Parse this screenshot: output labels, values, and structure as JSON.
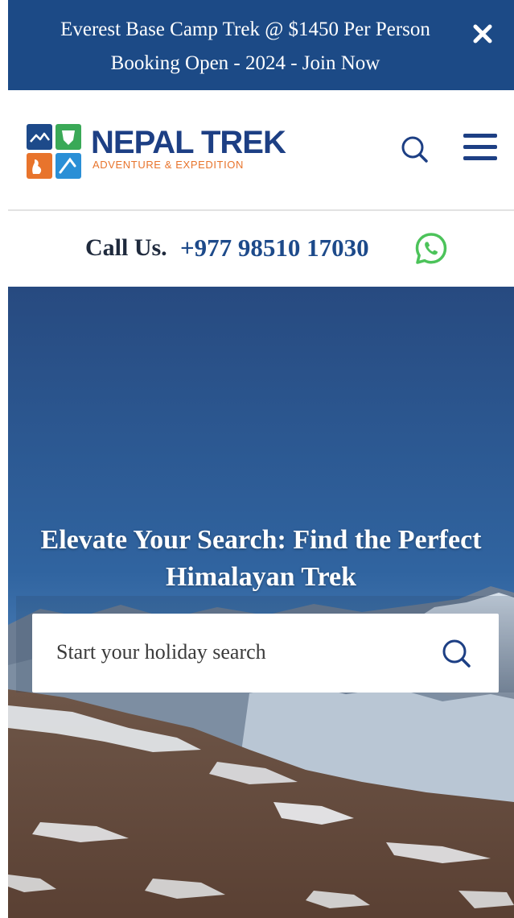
{
  "promo": {
    "line1": "Everest Base Camp Trek @ $1450 Per Person",
    "line2": "Booking Open - 2024 - Join Now",
    "close_icon": "close-icon",
    "background": "#1c4a86"
  },
  "header": {
    "logo": {
      "name": "NEPAL TREK",
      "tagline": "ADVENTURE & EXPEDITION",
      "brand_color": "#1d3f84",
      "tagline_color": "#e8742c"
    },
    "search_icon": "search-icon",
    "menu_icon": "hamburger-menu-icon"
  },
  "callbar": {
    "label": "Call Us.",
    "number": "+977 98510 17030",
    "whatsapp_icon": "whatsapp-icon",
    "whatsapp_color": "#4cc35a"
  },
  "hero": {
    "title": "Elevate Your Search: Find the Perfect Himalayan Trek",
    "search": {
      "placeholder": "Start your holiday search",
      "value": "",
      "icon": "search-icon"
    }
  }
}
